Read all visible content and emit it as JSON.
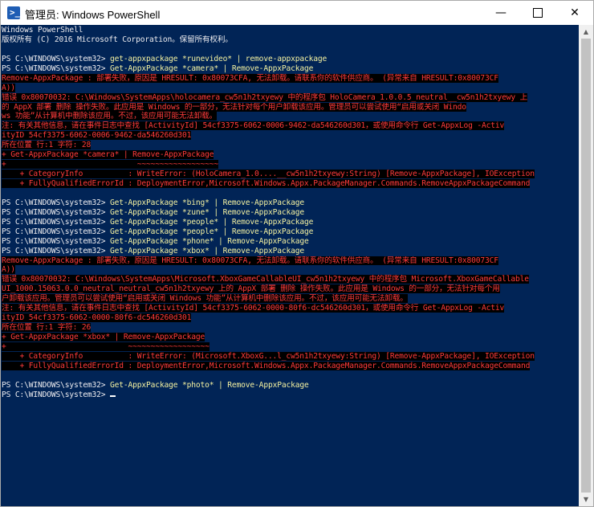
{
  "window": {
    "title": "管理员: Windows PowerShell",
    "icon": "powershell-icon",
    "controls": {
      "minimize": "—",
      "close": "✕"
    }
  },
  "console": {
    "lines": [
      {
        "segments": [
          {
            "text": "Windows PowerShell",
            "c": "w"
          }
        ]
      },
      {
        "segments": [
          {
            "text": "版权所有 (C) 2016 Microsoft Corporation。保留所有权利。",
            "c": "w"
          }
        ]
      },
      {
        "segments": [
          {
            "text": "",
            "c": "w"
          }
        ]
      },
      {
        "segments": [
          {
            "text": "PS C:\\WINDOWS\\system32> ",
            "c": "w"
          },
          {
            "text": "get-appxpackage *runevideo* | remove-appxpackage",
            "c": "y"
          }
        ]
      },
      {
        "segments": [
          {
            "text": "PS C:\\WINDOWS\\system32> ",
            "c": "w"
          },
          {
            "text": "Get-AppxPackage *camera* | Remove-AppxPackage",
            "c": "y"
          }
        ]
      },
      {
        "segments": [
          {
            "text": "Remove-AppxPackage : 部署失败，原因是 HRESULT: 0x80073CFA, 无法卸载。请联系你的软件供应商。 (异常来自 HRESULT:0x80073CF",
            "c": "r"
          }
        ]
      },
      {
        "segments": [
          {
            "text": "A))",
            "c": "r"
          }
        ]
      },
      {
        "segments": [
          {
            "text": "错误 0x80070032: C:\\Windows\\SystemApps\\holocamera_cw5n1h2txyewy 中的程序包 HoloCamera_1.0.0.5_neutral__cw5n1h2txyewy 上",
            "c": "r"
          }
        ]
      },
      {
        "segments": [
          {
            "text": "的 AppX 部署 删除 操作失败。此应用是 Windows 的一部分，无法针对每个用户卸载该应用。管理员可以尝试使用“启用或关闭 Windo",
            "c": "r"
          }
        ]
      },
      {
        "segments": [
          {
            "text": "ws 功能”从计算机中删除该应用。不过，该应用可能无法卸载。",
            "c": "r"
          }
        ]
      },
      {
        "segments": [
          {
            "text": "注: 有关其他信息，请在事件日志中查找 [ActivityId] 54cf3375-6062-0006-9462-da546260d301，或使用命令行 Get-AppxLog -Activ",
            "c": "r"
          }
        ]
      },
      {
        "segments": [
          {
            "text": "ityID 54cf3375-6062-0006-9462-da546260d301",
            "c": "r"
          }
        ]
      },
      {
        "segments": [
          {
            "text": "所在位置 行:1 字符: 28",
            "c": "r"
          }
        ]
      },
      {
        "segments": [
          {
            "text": "+ Get-AppxPackage *camera* | Remove-AppxPackage",
            "c": "r"
          }
        ]
      },
      {
        "segments": [
          {
            "text": "+                             ~~~~~~~~~~~~~~~~~~",
            "c": "r"
          }
        ]
      },
      {
        "segments": [
          {
            "text": "    + CategoryInfo          : WriteError: (HoloCamera_1.0....__cw5n1h2txyewy:String) [Remove-AppxPackage], IOException",
            "c": "r"
          }
        ]
      },
      {
        "segments": [
          {
            "text": "    + FullyQualifiedErrorId : DeploymentError,Microsoft.Windows.Appx.PackageManager.Commands.RemoveAppxPackageCommand",
            "c": "r"
          }
        ]
      },
      {
        "segments": [
          {
            "text": "",
            "c": "r"
          }
        ]
      },
      {
        "segments": [
          {
            "text": "PS C:\\WINDOWS\\system32> ",
            "c": "w"
          },
          {
            "text": "Get-AppxPackage *bing* | Remove-AppxPackage",
            "c": "y"
          }
        ]
      },
      {
        "segments": [
          {
            "text": "PS C:\\WINDOWS\\system32> ",
            "c": "w"
          },
          {
            "text": "Get-AppxPackage *zune* | Remove-AppxPackage",
            "c": "y"
          }
        ]
      },
      {
        "segments": [
          {
            "text": "PS C:\\WINDOWS\\system32> ",
            "c": "w"
          },
          {
            "text": "Get-AppxPackage *people* | Remove-AppxPackage",
            "c": "y"
          }
        ]
      },
      {
        "segments": [
          {
            "text": "PS C:\\WINDOWS\\system32> ",
            "c": "w"
          },
          {
            "text": "Get-AppxPackage *people* | Remove-AppxPackage",
            "c": "y"
          }
        ]
      },
      {
        "segments": [
          {
            "text": "PS C:\\WINDOWS\\system32> ",
            "c": "w"
          },
          {
            "text": "Get-AppxPackage *phone* | Remove-AppxPackage",
            "c": "y"
          }
        ]
      },
      {
        "segments": [
          {
            "text": "PS C:\\WINDOWS\\system32> ",
            "c": "w"
          },
          {
            "text": "Get-AppxPackage *xbox* | Remove-AppxPackage",
            "c": "y"
          }
        ]
      },
      {
        "segments": [
          {
            "text": "Remove-AppxPackage : 部署失败，原因是 HRESULT: 0x80073CFA, 无法卸载。请联系你的软件供应商。 (异常来自 HRESULT:0x80073CF",
            "c": "r"
          }
        ]
      },
      {
        "segments": [
          {
            "text": "A))",
            "c": "r"
          }
        ]
      },
      {
        "segments": [
          {
            "text": "错误 0x80070032: C:\\Windows\\SystemApps\\Microsoft.XboxGameCallableUI_cw5n1h2txyewy 中的程序包 Microsoft.XboxGameCallable",
            "c": "r"
          }
        ]
      },
      {
        "segments": [
          {
            "text": "UI_1000.15063.0.0_neutral_neutral_cw5n1h2txyewy 上的 AppX 部署 删除 操作失败。此应用是 Windows 的一部分，无法针对每个用",
            "c": "r"
          }
        ]
      },
      {
        "segments": [
          {
            "text": "户卸载该应用。管理员可以尝试使用“启用或关闭 Windows 功能”从计算机中删除该应用。不过，该应用可能无法卸载。",
            "c": "r"
          }
        ]
      },
      {
        "segments": [
          {
            "text": "注: 有关其他信息，请在事件日志中查找 [ActivityId] 54cf3375-6062-0000-80f6-dc546260d301，或使用命令行 Get-AppxLog -Activ",
            "c": "r"
          }
        ]
      },
      {
        "segments": [
          {
            "text": "ityID 54cf3375-6062-0000-80f6-dc546260d301",
            "c": "r"
          }
        ]
      },
      {
        "segments": [
          {
            "text": "所在位置 行:1 字符: 26",
            "c": "r"
          }
        ]
      },
      {
        "segments": [
          {
            "text": "+ Get-AppxPackage *xbox* | Remove-AppxPackage",
            "c": "r"
          }
        ]
      },
      {
        "segments": [
          {
            "text": "+                           ~~~~~~~~~~~~~~~~~~",
            "c": "r"
          }
        ]
      },
      {
        "segments": [
          {
            "text": "    + CategoryInfo          : WriteError: (Microsoft.XboxG...l_cw5n1h2txyewy:String) [Remove-AppxPackage], IOException",
            "c": "r"
          }
        ]
      },
      {
        "segments": [
          {
            "text": "    + FullyQualifiedErrorId : DeploymentError,Microsoft.Windows.Appx.PackageManager.Commands.RemoveAppxPackageCommand",
            "c": "r"
          }
        ]
      },
      {
        "segments": [
          {
            "text": "",
            "c": "r"
          }
        ]
      },
      {
        "segments": [
          {
            "text": "PS C:\\WINDOWS\\system32> ",
            "c": "w"
          },
          {
            "text": "Get-AppxPackage *photo* | Remove-AppxPackage",
            "c": "y"
          }
        ]
      },
      {
        "segments": [
          {
            "text": "PS C:\\WINDOWS\\system32> ",
            "c": "w"
          }
        ]
      }
    ],
    "error_highlight_ranges": [
      [
        5,
        16
      ],
      [
        24,
        35
      ]
    ],
    "colors": {
      "background": "#012456",
      "output_text": "#eeedf0",
      "command_text": "#f5f2a1",
      "error_text": "#ff3b3b",
      "error_background": "#000000"
    }
  },
  "scrollbar": {
    "up_arrow": "▲",
    "down_arrow": "▼"
  }
}
